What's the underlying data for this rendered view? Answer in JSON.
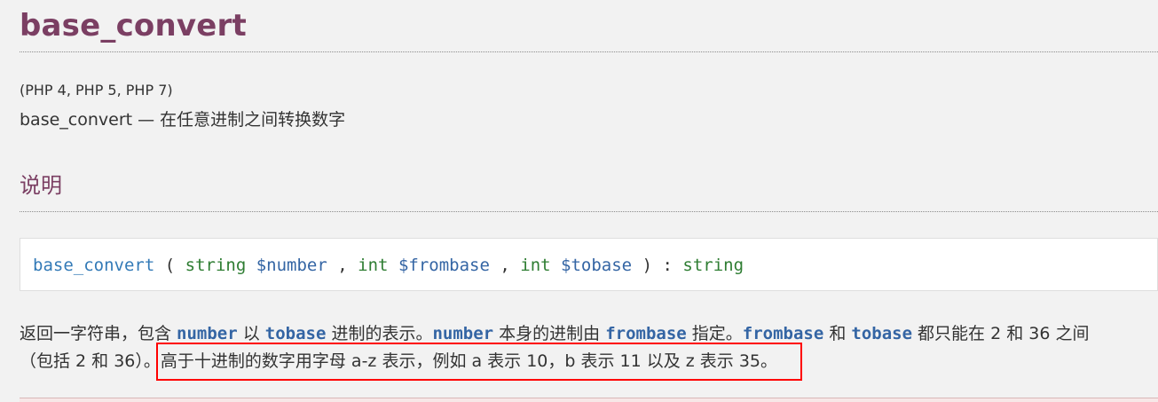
{
  "page": {
    "title": "base_convert",
    "versions": "(PHP 4, PHP 5, PHP 7)",
    "refpurpose": "base_convert — 在任意进制之间转换数字",
    "section_title": "说明"
  },
  "synopsis": {
    "function": "base_convert",
    "open_paren": "(",
    "param1_type": "string",
    "param1_name": "$number",
    "comma1": ",",
    "param2_type": "int",
    "param2_name": "$frombase",
    "comma2": ",",
    "param3_type": "int",
    "param3_name": "$tobase",
    "close_paren": ")",
    "return_sep": ":",
    "return_type": "string"
  },
  "description": {
    "line1": {
      "t1": "返回一字符串，包含 ",
      "w1": "number",
      "t2": " 以 ",
      "w2": "tobase",
      "t3": " 进制的表示。",
      "w3": "number",
      "t4": " 本身的进制由 ",
      "w4": "frombase",
      "t5": " 指定。",
      "w5": "frombase",
      "t6": " 和 ",
      "w6": "tobase",
      "t7": " 都只能在 2 和 36 之间"
    },
    "line2": {
      "t1": "（包括 2 和 36）。",
      "t2": "高于十进制的数字用字母 a-z 表示，例如 a 表示 10，b 表示 11 以及 z 表示 35。"
    }
  },
  "colors": {
    "title": "#7b3f63",
    "code_blue": "#3465a4",
    "type_green": "#2e7d32",
    "highlight": "#ff0000",
    "background": "#f2f2f2"
  }
}
